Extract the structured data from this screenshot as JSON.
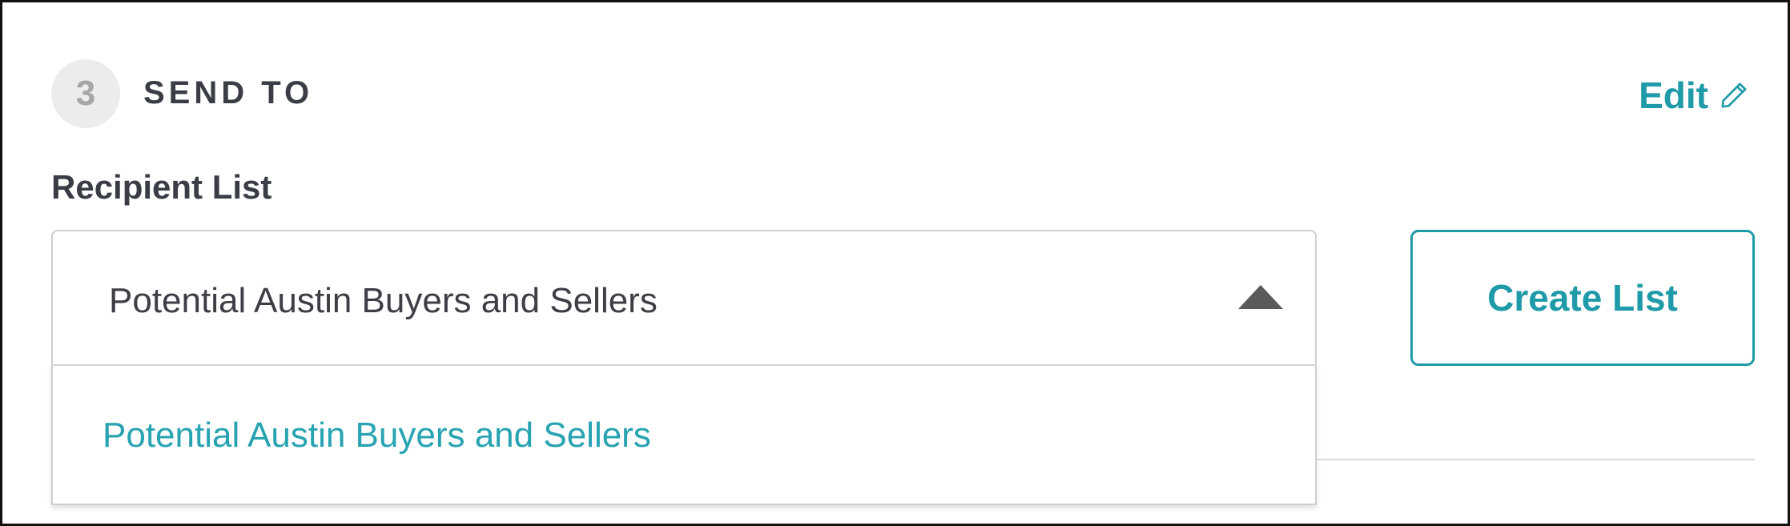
{
  "section": {
    "step_number": "3",
    "title": "SEND TO",
    "edit_label": "Edit",
    "edit_icon": "pencil-icon"
  },
  "recipient": {
    "label": "Recipient List",
    "selected_value": "Potential Austin Buyers and Sellers",
    "caret_icon": "caret-up-icon",
    "options": [
      "Potential Austin Buyers and Sellers"
    ]
  },
  "actions": {
    "create_list_label": "Create List"
  },
  "colors": {
    "accent": "#1f9aa8",
    "option_text": "#27a3b2",
    "heading_text": "#3a3d45",
    "step_circle_bg": "#ececec"
  }
}
